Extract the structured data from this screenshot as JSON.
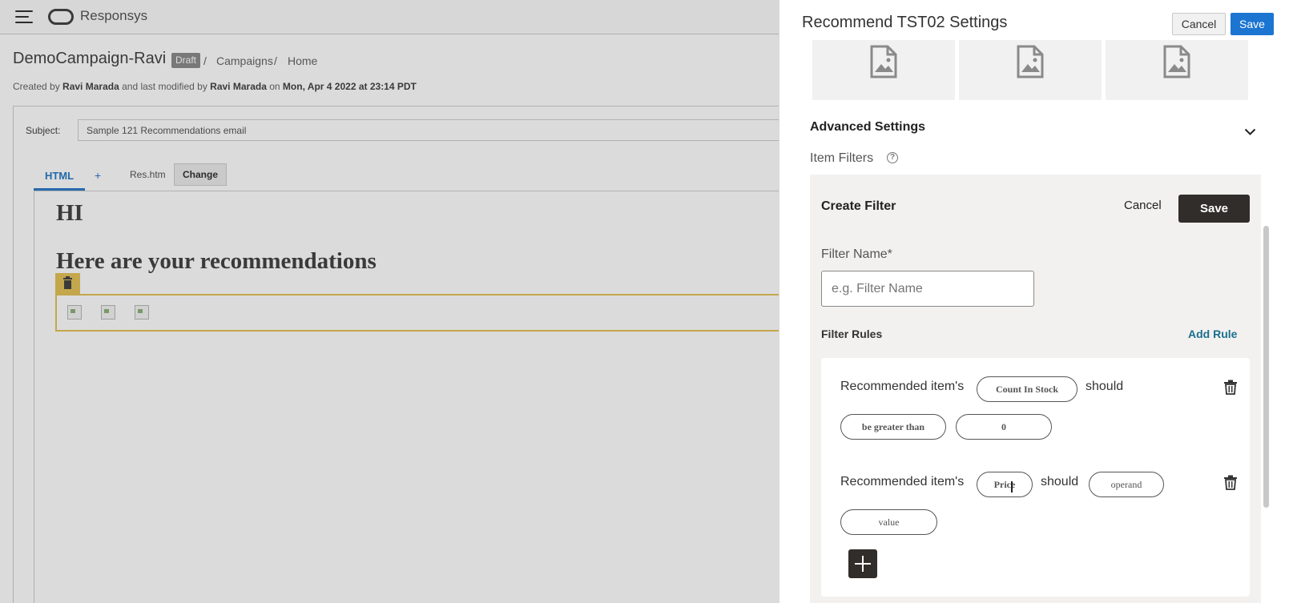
{
  "app": {
    "brand": "Responsys",
    "campaign_title": "DemoCampaign-Ravi",
    "draft_badge": "Draft",
    "breadcrumb": {
      "sep1": "/",
      "campaigns": "Campaigns",
      "sep2": "/",
      "home": "Home"
    },
    "meta": {
      "created_by_label": "Created by",
      "creator": "Ravi Marada",
      "modified_label": "and last modified by",
      "modifier": "Ravi Marada",
      "on_label": "on",
      "date": "Mon, Apr 4 2022 at 23:14 PDT"
    },
    "subject_label": "Subject:",
    "subject_value": "Sample 121 Recommendations email",
    "tabs": {
      "html": "HTML",
      "plus": "+"
    },
    "file_name": "Res.htm",
    "change_label": "Change",
    "content": {
      "heading_hi": "HI",
      "heading_recs": "Here are your recommendations"
    }
  },
  "panel": {
    "title": "Recommend TST02 Settings",
    "cancel_label": "Cancel",
    "save_label": "Save",
    "advanced_settings": "Advanced Settings",
    "item_filters": "Item Filters",
    "help_glyph": "?",
    "create_filter": {
      "title": "Create Filter",
      "cancel_label": "Cancel",
      "save_label": "Save",
      "filter_name_label": "Filter Name*",
      "filter_name_placeholder": "e.g. Filter Name",
      "filter_rules_label": "Filter Rules",
      "add_rule_label": "Add Rule",
      "rules": [
        {
          "prefix": "Recommended item's",
          "attribute": "Count In Stock",
          "verb": "should",
          "operand": "be greater than",
          "value": "0"
        },
        {
          "prefix": "Recommended item's",
          "attribute": "Price",
          "verb": "should",
          "operand": "operand",
          "value": "value"
        }
      ]
    }
  },
  "colors": {
    "primary_blue": "#1b75d1",
    "dark_button": "#312d2a",
    "highlight_yellow": "#e5c35a",
    "link_teal": "#1b6f8e"
  }
}
